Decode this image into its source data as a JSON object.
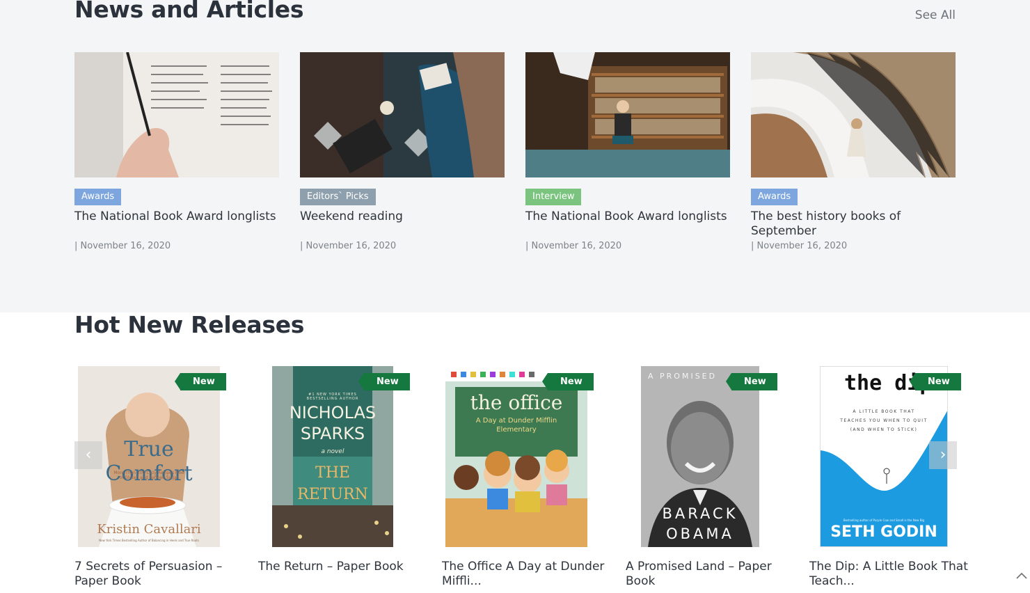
{
  "news": {
    "title": "News and Articles",
    "see_all": "See All",
    "articles": [
      {
        "tag": "Awards",
        "title": "The National Book Award longlists",
        "date": "| November 16, 2020"
      },
      {
        "tag": "Editors` Picks",
        "title": "Weekend reading",
        "date": "| November 16, 2020"
      },
      {
        "tag": "Interview",
        "title": "The National Book Award longlists",
        "date": "| November 16, 2020"
      },
      {
        "tag": "Awards",
        "title": "The best history books of September",
        "date": "| November 16, 2020"
      }
    ]
  },
  "hot": {
    "title": "Hot New Releases",
    "badge": "New",
    "products": [
      {
        "title": "7 Secrets of Persuasion – Paper Book",
        "cover_title": "True Comfort",
        "cover_sub": "More Than 100 Cozy Recipes Free of Gluten and Refined Sugar",
        "cover_author": "Kristin Cavallari",
        "cover_note": "New York Times Bestselling Author of Balancing in Heels and True Roots"
      },
      {
        "title": "The Return – Paper Book",
        "cover_top": "#1 NEW YORK TIMES BESTSELLING AUTHOR",
        "cover_author": "NICHOLAS SPARKS",
        "cover_title": "THE RETURN",
        "cover_mid": "a novel"
      },
      {
        "title": "The Office A Day at Dunder Miffli...",
        "cover_title": "the office",
        "cover_sub": "A Day at Dunder Mifflin Elementary"
      },
      {
        "title": "A Promised Land – Paper Book",
        "cover_top": "A PROMISED",
        "cover_author": "BARACK OBAMA"
      },
      {
        "title": "The Dip: A Little Book That Teach...",
        "cover_title": "the dip",
        "cover_sub": "A LITTLE BOOK THAT TEACHES YOU WHEN TO QUIT (AND WHEN TO STICK)",
        "cover_author": "SETH GODIN",
        "cover_note": "Bestselling author of Purple Cow and Small is the New Big"
      }
    ]
  },
  "colors": {
    "badge": "#14783f",
    "tag_awards": "#7ea6de",
    "tag_editors": "#8ea0ad",
    "tag_interview": "#7bc47f"
  },
  "icons": {
    "prev": "chevron-left-icon",
    "next": "chevron-right-icon",
    "scroll_top": "chevron-up-icon"
  }
}
